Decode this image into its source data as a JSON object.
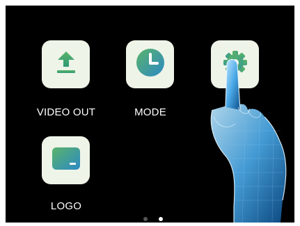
{
  "apps": [
    {
      "label": "VIDEO OUT",
      "icon": "upload-icon"
    },
    {
      "label": "MODE",
      "icon": "clock-icon"
    },
    {
      "label": "",
      "icon": "gear-icon"
    },
    {
      "label": "LOGO",
      "icon": "display-icon"
    }
  ],
  "pager": {
    "pages": 2,
    "active_page": 2
  },
  "colors": {
    "background": "#000000",
    "tile": "#eef4e8",
    "icon_gradient_start": "#5ab36a",
    "icon_gradient_end": "#2d8ac4",
    "dot_inactive": "#555555",
    "dot_active": "#ffffff"
  }
}
